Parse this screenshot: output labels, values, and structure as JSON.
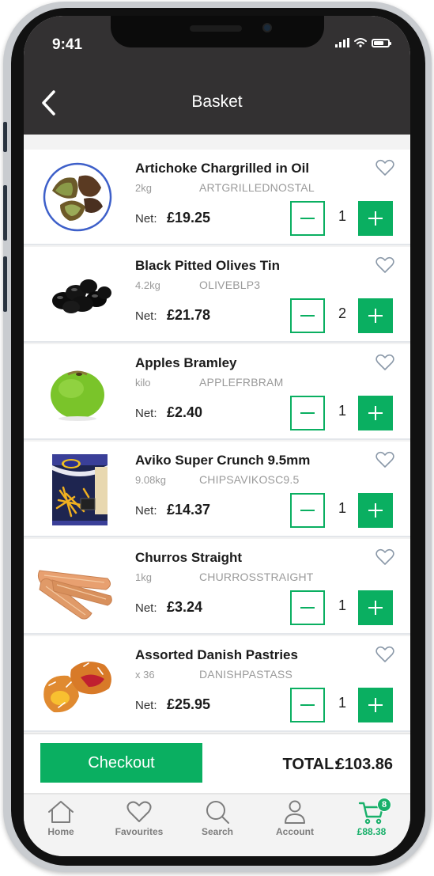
{
  "status_bar": {
    "time": "9:41"
  },
  "header": {
    "title": "Basket",
    "back_icon": "chevron-left-icon"
  },
  "items": [
    {
      "name": "Artichoke Chargrilled in Oil",
      "size": "2kg",
      "code": "ARTGRILLEDNOSTAL",
      "net_label": "Net:",
      "price": "£19.25",
      "quantity": "1",
      "image": "artichoke-image"
    },
    {
      "name": "Black Pitted Olives Tin",
      "size": "4.2kg",
      "code": "OLIVEBLP3",
      "net_label": "Net:",
      "price": "£21.78",
      "quantity": "2",
      "image": "olives-image"
    },
    {
      "name": "Apples Bramley",
      "size": "kilo",
      "code": "APPLEFRBRAM",
      "net_label": "Net:",
      "price": "£2.40",
      "quantity": "1",
      "image": "apple-image"
    },
    {
      "name": "Aviko Super Crunch 9.5mm",
      "size": "9.08kg",
      "code": "CHIPSAVIKOSC9.5",
      "net_label": "Net:",
      "price": "£14.37",
      "quantity": "1",
      "image": "chips-bag-image"
    },
    {
      "name": "Churros Straight",
      "size": "1kg",
      "code": "CHURROSSTRAIGHT",
      "net_label": "Net:",
      "price": "£3.24",
      "quantity": "1",
      "image": "churros-image"
    },
    {
      "name": "Assorted Danish Pastries",
      "size": "x 36",
      "code": "DANISHPASTASS",
      "net_label": "Net:",
      "price": "£25.95",
      "quantity": "1",
      "image": "danish-pastry-image"
    }
  ],
  "checkout": {
    "button_label": "Checkout",
    "total_label": "TOTAL:",
    "total_value": "£103.86"
  },
  "tabbar": {
    "tabs": [
      {
        "label": "Home",
        "icon": "home-icon"
      },
      {
        "label": "Favourites",
        "icon": "heart-icon"
      },
      {
        "label": "Search",
        "icon": "search-icon"
      },
      {
        "label": "Account",
        "icon": "user-icon"
      },
      {
        "label": "£88.38",
        "icon": "cart-icon",
        "badge": "8",
        "active": true
      }
    ]
  },
  "colors": {
    "accent": "#0aaf61",
    "header_bg": "#333132",
    "tab_active": "#18b06a"
  }
}
